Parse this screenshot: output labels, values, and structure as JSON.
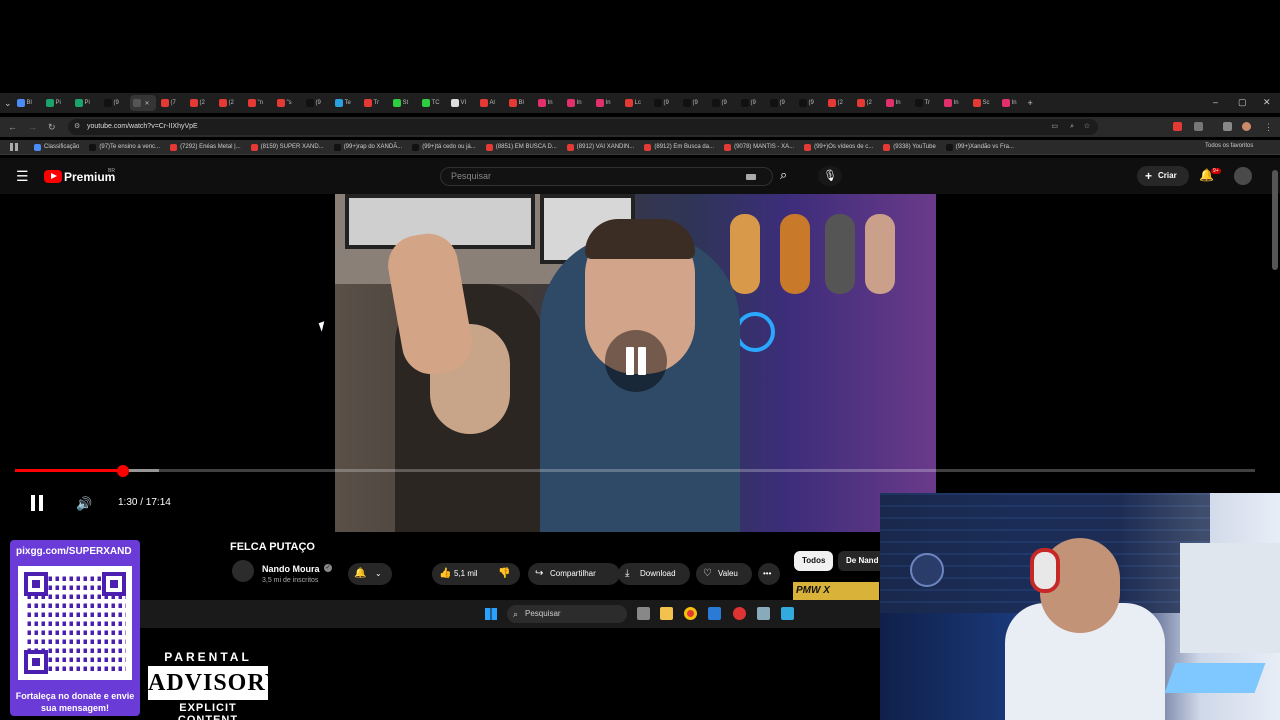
{
  "browser": {
    "tabs": [
      {
        "label": "Bl",
        "color": "#4a8df6"
      },
      {
        "label": "Pi",
        "color": "#1aa36b"
      },
      {
        "label": "Pi",
        "color": "#1aa36b"
      },
      {
        "label": "(9",
        "color": "#111111"
      },
      {
        "label": "",
        "color": "#555555",
        "active": true
      },
      {
        "label": "(7",
        "color": "#e53935"
      },
      {
        "label": "(2",
        "color": "#e53935"
      },
      {
        "label": "(2",
        "color": "#e53935"
      },
      {
        "label": "\"n",
        "color": "#e53935"
      },
      {
        "label": "\"s",
        "color": "#e53935"
      },
      {
        "label": "(9",
        "color": "#111111"
      },
      {
        "label": "Te",
        "color": "#2aa0e0"
      },
      {
        "label": "Tr",
        "color": "#e53935"
      },
      {
        "label": "St",
        "color": "#2ecc40"
      },
      {
        "label": "TC",
        "color": "#2ecc40"
      },
      {
        "label": "VI",
        "color": "#dddddd"
      },
      {
        "label": "Al",
        "color": "#e53935"
      },
      {
        "label": "Bl",
        "color": "#e53935"
      },
      {
        "label": "In",
        "color": "#e1306c"
      },
      {
        "label": "In",
        "color": "#e1306c"
      },
      {
        "label": "In",
        "color": "#e1306c"
      },
      {
        "label": "Lc",
        "color": "#e53935"
      },
      {
        "label": "(9",
        "color": "#111111"
      },
      {
        "label": "(9",
        "color": "#111111"
      },
      {
        "label": "(9",
        "color": "#111111"
      },
      {
        "label": "(9",
        "color": "#111111"
      },
      {
        "label": "(9",
        "color": "#111111"
      },
      {
        "label": "(9",
        "color": "#111111"
      },
      {
        "label": "(2",
        "color": "#e53935"
      },
      {
        "label": "(2",
        "color": "#e53935"
      },
      {
        "label": "In",
        "color": "#e1306c"
      },
      {
        "label": "Tr",
        "color": "#111111"
      },
      {
        "label": "In",
        "color": "#e1306c"
      },
      {
        "label": "Sc",
        "color": "#e53935"
      },
      {
        "label": "In",
        "color": "#e1306c"
      }
    ],
    "url": "youtube.com/watch?v=Cr-IIXhyVpE",
    "bookmarks": [
      {
        "label": "Classificação",
        "color": "#4a8df6"
      },
      {
        "label": "(97)Te ensino a venc...",
        "color": "#111111"
      },
      {
        "label": "(7292) Enéas Metal |...",
        "color": "#e53935"
      },
      {
        "label": "(8159) SUPER XAND...",
        "color": "#e53935"
      },
      {
        "label": "(99+)rap do XANDÃ...",
        "color": "#111111"
      },
      {
        "label": "(99+)tá cedo ou já...",
        "color": "#111111"
      },
      {
        "label": "(8851) EM BUSCA D...",
        "color": "#e53935"
      },
      {
        "label": "(8912) VAI XANDIN...",
        "color": "#e53935"
      },
      {
        "label": "(8912) Em Busca da...",
        "color": "#e53935"
      },
      {
        "label": "(9078) MANTIS - XA...",
        "color": "#e53935"
      },
      {
        "label": "(99+)Os vídeos de c...",
        "color": "#e53935"
      },
      {
        "label": "(9338) YouTube",
        "color": "#e53935"
      },
      {
        "label": "(99+)Xandão vs Fra...",
        "color": "#111111"
      }
    ],
    "all_bookmarks": "Todos os favoritos"
  },
  "youtube": {
    "brand": "Premium",
    "region": "BR",
    "search_placeholder": "Pesquisar",
    "create_label": "Criar",
    "notif_count": "9+"
  },
  "player": {
    "time": "1:30 / 17:14",
    "progress_fraction": 0.087,
    "buffer_fraction": 0.116
  },
  "video": {
    "title": "FELCA PUTAÇO",
    "channel": "Nando Moura",
    "subscribers": "3,5 mi de inscritos",
    "likes": "5,1 mil",
    "share": "Compartilhar",
    "download": "Download",
    "thanks": "Valeu",
    "chips": [
      "Todos",
      "De Nand"
    ]
  },
  "taskbar": {
    "search": "Pesquisar"
  },
  "overlay": {
    "banner": "PMW X",
    "qr_url": "pixgg.com/SUPERXAND",
    "qr_caption": "Fortaleça no donate e envie sua mensagem!",
    "advisory_top": "PARENTAL",
    "advisory_mid": "ADVISORY",
    "advisory_bot": "EXPLICIT CONTENT"
  }
}
